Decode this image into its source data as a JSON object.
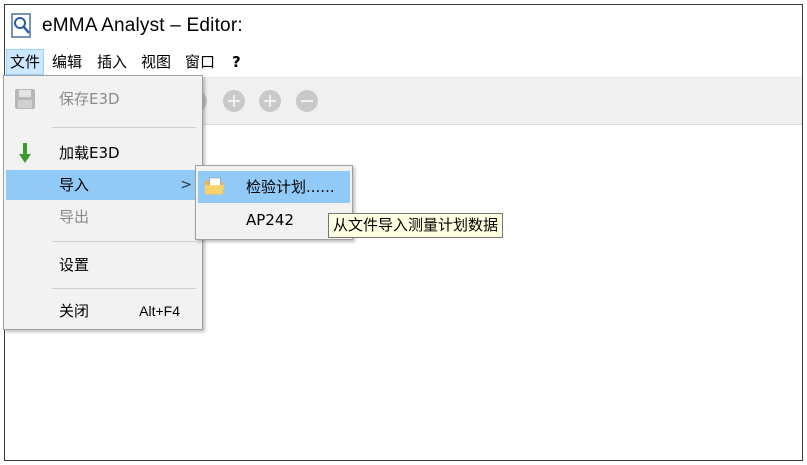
{
  "window": {
    "title": "eMMA Analyst – Editor:"
  },
  "menubar": {
    "items": [
      {
        "label": "文件"
      },
      {
        "label": "编辑"
      },
      {
        "label": "插入"
      },
      {
        "label": "视图"
      },
      {
        "label": "窗口"
      },
      {
        "label": "?"
      }
    ]
  },
  "file_menu": {
    "save": {
      "label": "保存E3D"
    },
    "load": {
      "label": "加载E3D"
    },
    "import": {
      "label": "导入",
      "arrow": ">"
    },
    "export": {
      "label": "导出"
    },
    "settings": {
      "label": "设置"
    },
    "close": {
      "label": "关闭",
      "shortcut": "Alt+F4"
    }
  },
  "import_submenu": {
    "items": [
      {
        "label": "检验计划......"
      },
      {
        "label": "AP242"
      }
    ]
  },
  "tooltip": {
    "text": "从文件导入测量计划数据"
  },
  "colors": {
    "highlight": "#91c9f7",
    "menu_active": "#cce8ff",
    "menu_bg": "#f2f2f2",
    "tooltip_bg": "#ffffe1",
    "load_arrow": "#3c9a2e"
  },
  "icons": [
    "magnifier-doc-icon",
    "save-disk-icon",
    "down-arrow-icon",
    "folder-open-icon"
  ]
}
